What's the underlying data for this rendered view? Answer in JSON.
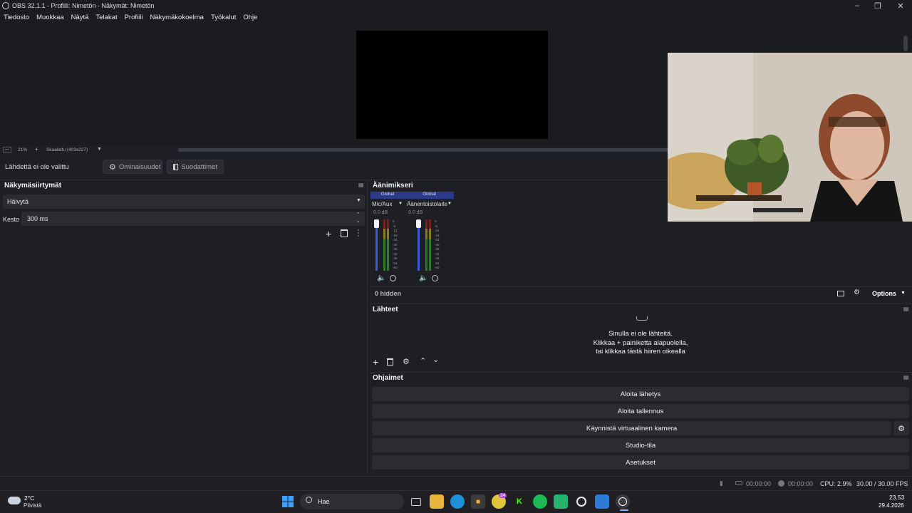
{
  "window": {
    "title": "OBS 32.1.1 - Profiili: Nimetön - Näkymät: Nimetön"
  },
  "menu": [
    "Tiedosto",
    "Muokkaa",
    "Näytä",
    "Telakat",
    "Profiili",
    "Näkymäkokoelma",
    "Työkalut",
    "Ohje"
  ],
  "zoom": {
    "minus": "—",
    "value": "21%",
    "plus": "+",
    "mode": "Skaalattu (403x227)"
  },
  "source_toolbar": {
    "no_source": "Lähdettä ei ole valittu",
    "properties": "Ominaisuudet",
    "filters": "Suodattimet"
  },
  "transitions": {
    "title": "Näkymäsiirtymät",
    "selected": "Häivytä",
    "duration_label": "Kesto",
    "duration_value": "300 ms"
  },
  "mixer": {
    "title": "Äänimikseri",
    "channels": [
      {
        "badge": "Global",
        "name": "Mic/Aux",
        "db": "0.0 dB"
      },
      {
        "badge": "Global",
        "name": "Äänentoistolaite",
        "db": "0.0 dB"
      }
    ],
    "scale": [
      "0",
      "-6",
      "-12",
      "-18",
      "-24",
      "-30",
      "-36",
      "-42",
      "-48",
      "-54",
      "-60"
    ],
    "hidden": "0 hidden",
    "options": "Options"
  },
  "sources": {
    "title": "Lähteet",
    "empty_line1": "Sinulla ei ole lähteitä.",
    "empty_line2": "Klikkaa + painiketta alapuolella,",
    "empty_line3": "tai klikkaa tästä hiiren oikealla"
  },
  "controls": {
    "title": "Ohjaimet",
    "start_stream": "Aloita lähetys",
    "start_record": "Aloita tallennus",
    "virtual_cam": "Käynnistä virtuaalinen kamera",
    "studio": "Studio-tila",
    "settings": "Asetukset"
  },
  "status": {
    "stream_time": "00:00:00",
    "record_time": "00:00:00",
    "cpu": "CPU: 2.9%",
    "fps": "30.00 / 30.00 FPS"
  },
  "taskbar": {
    "weather_temp": "2°C",
    "weather_desc": "Pilvistä",
    "search": "Hae",
    "badge": "24",
    "time": "23.53",
    "date": "29.4.2026"
  },
  "colors": {
    "bg": "#1e1f24",
    "accent": "#2b3b8a",
    "fader": "#3a5bd9"
  }
}
